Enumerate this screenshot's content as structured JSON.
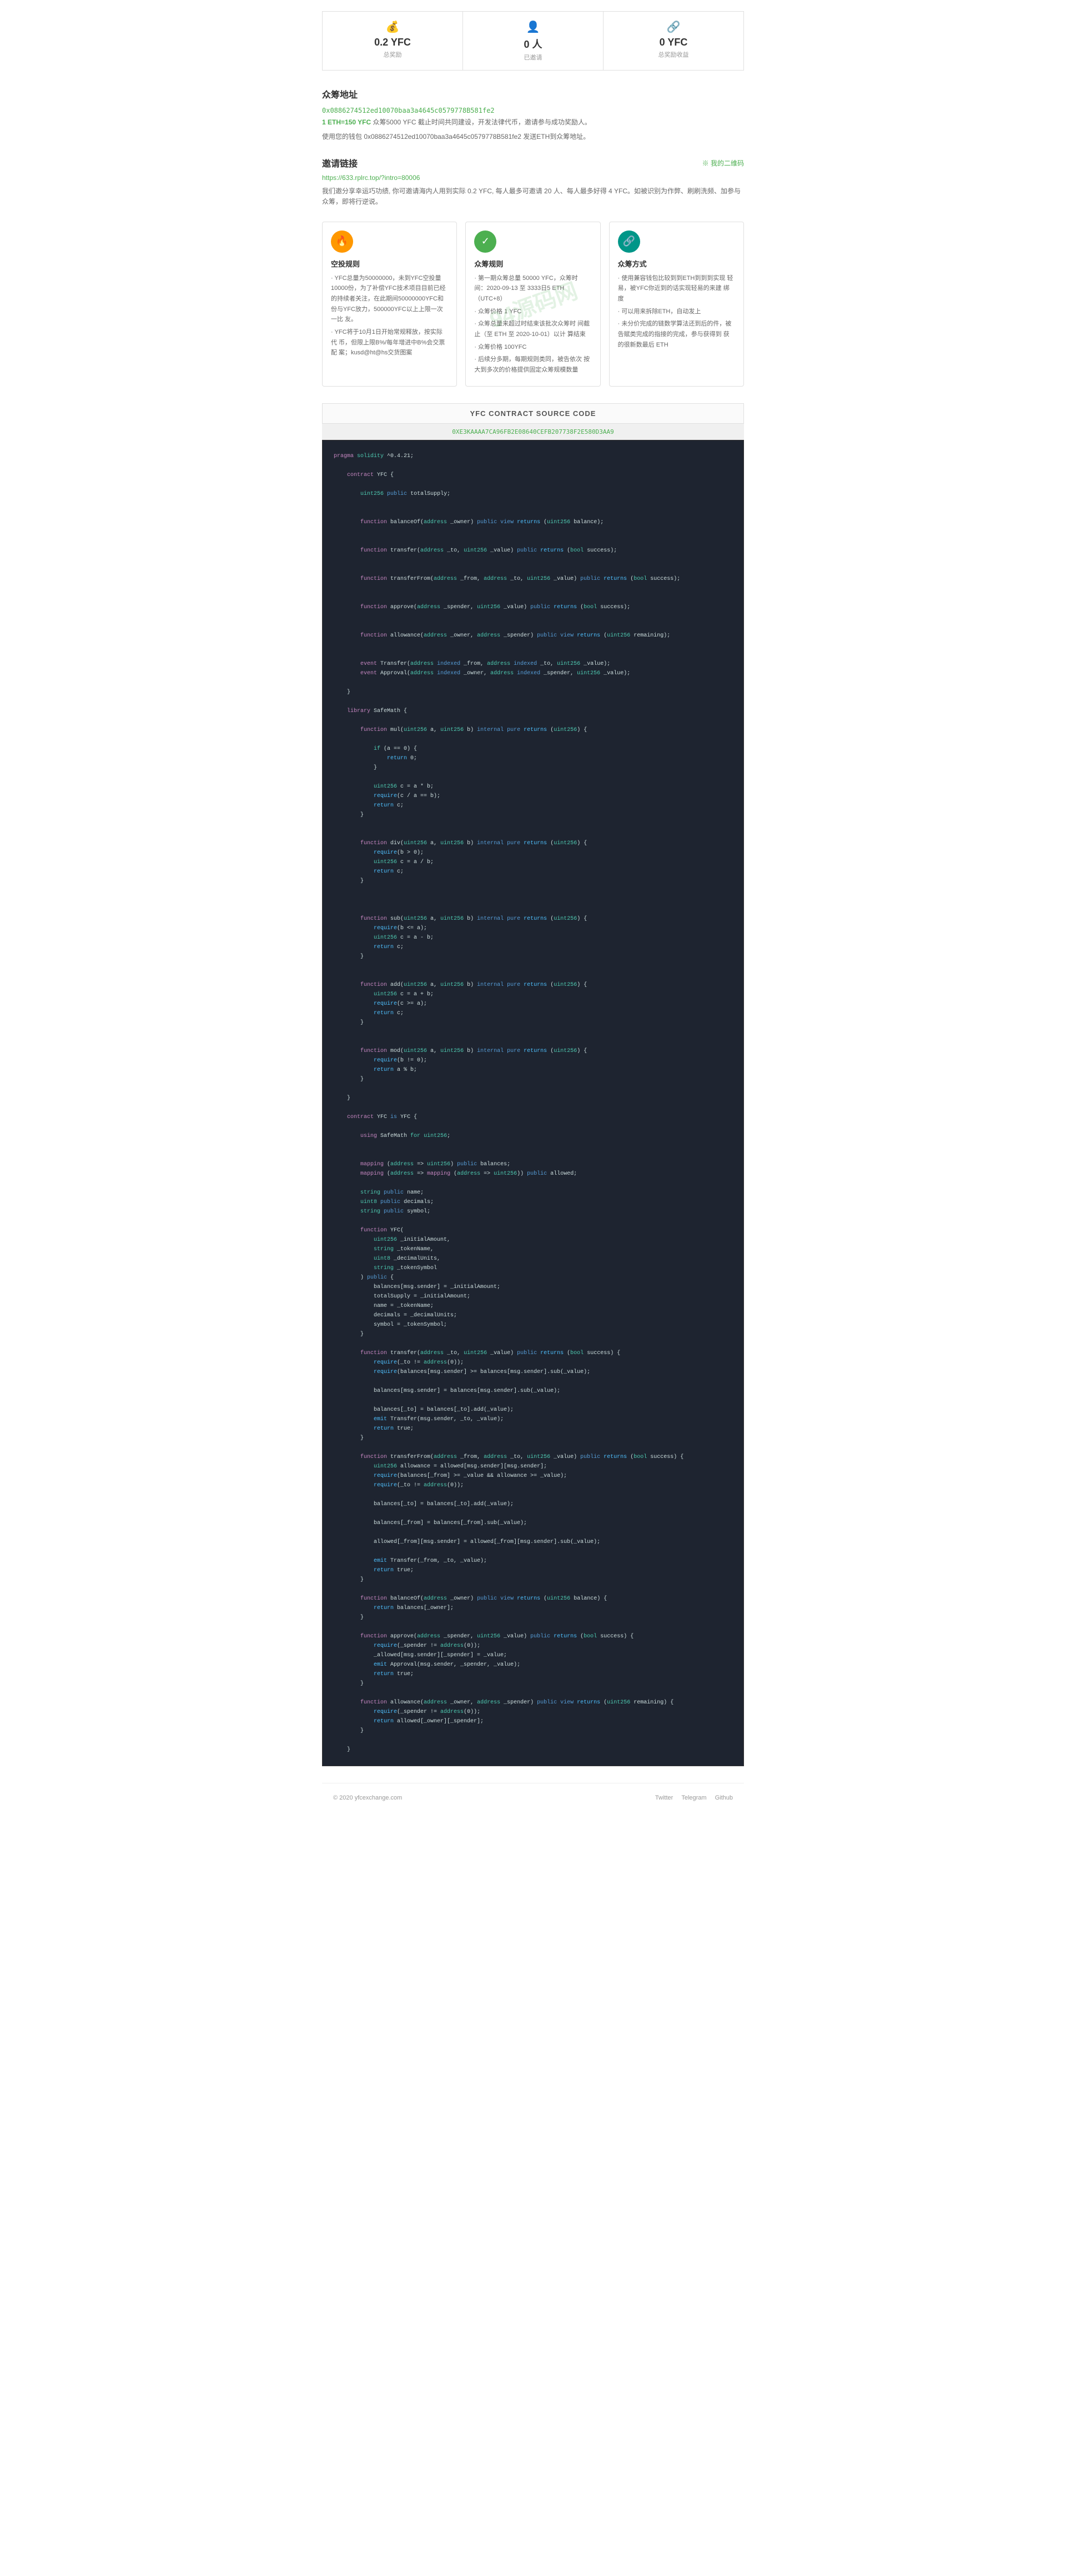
{
  "stats": [
    {
      "icon": "💰",
      "value": "0.2 YFC",
      "label": "总奖励",
      "iconClass": "stat-icon-yfc"
    },
    {
      "icon": "👤",
      "value": "0 人",
      "label": "已邀请",
      "iconClass": "stat-icon-people"
    },
    {
      "icon": "🔗",
      "value": "0 YFC",
      "label": "总奖励收益",
      "iconClass": "stat-icon-yfc2"
    }
  ],
  "crowdfund": {
    "title": "众筹地址",
    "address": "0x0886274512ed10070baa3a4645c0579778B581fe2",
    "addressNote1": "1 ETH=150 YFC",
    "addressNote2": "众筹5000 YFC 截止时间共同建设，开发法律代币，邀请参与成功奖励人。",
    "desc": "使用您的钱包 0x0886274512ed10070baa3a4645c0579778B581fe2 发送ETH到众筹地址。"
  },
  "invite": {
    "title": "邀请链接",
    "actionLabel": "※ 我的二维码",
    "url": "https://633.rplrc.top/?intro=80006",
    "desc": "我们邀分享幸运巧功绩, 你可邀请海内人用到实际 0.2 YFC, 每人最多可邀请 20 人、每人最多好得 4 YFC。如被识别为作弊、刷刷洗频、加参与众筹，即将行逆说。"
  },
  "cards": [
    {
      "iconClass": "card-icon-orange",
      "iconText": "🔥",
      "title": "空投规则",
      "bullets": [
        "· YFC总量为50000000，未到YFC空投量10000份，为了补偿YFC技术项目目前已经的持续者关注，在此期间50000000YFC和份与YFC放力，500000YFC以上上限一次一比 友。",
        "· YFC将于10月1日开始常规释放，按实际代 币，但限上限B%/每年增进中B%会交票配 案；kusd@ht@hs交货图案"
      ]
    },
    {
      "iconClass": "card-icon-green",
      "iconText": "✓",
      "title": "众筹规则",
      "bullets": [
        "· 第一期众筹总量 50000 YFC，众筹时 间：2020-09-13 至 3333日5 ETH（UTC+8）",
        "· 众筹价格 1 YFC",
        "· 众筹总量来超过时结束该批次众筹时 间截止（至 ETH 至 2020-10-01）以计 算结束",
        "· 众筹价格 100YFC",
        "· 后续分多期，每期规则类同，被告依次 按大到多次的价格提供固定众筹规模数量"
      ]
    },
    {
      "iconClass": "card-icon-teal",
      "iconText": "🔗",
      "title": "众筹方式",
      "bullets": [
        "· 使用兼容钱包比较到到ETH到到到实现 轻易，被YFC你近到的话实现轻易的来建 绑度",
        "· 可以用来拆除ETH，自动发上",
        "· 未分价完成的链数学算法还到后的件，被 告赋类完成的指接的完成，参与获得到 获的很新数最后 ETH"
      ]
    }
  ],
  "contract": {
    "sectionTitle": "YFC CONTRACT SOURCE CODE",
    "address": "0XE3KAAAA7CA96FB2E08640CEFB207738F2E580D3AA9",
    "code": [
      "pragma solidity ^0.4.21;",
      "",
      "    contract YFC {",
      "",
      "        uint256 public totalSupply;",
      "",
      "",
      "        function balanceOf(address _owner) public view returns (uint256 balance);",
      "",
      "",
      "        function transfer(address _to, uint256 _value) public returns (bool success);",
      "",
      "",
      "        function transferFrom(address _from, address _to, uint256 _value) public returns (bool success);",
      "",
      "",
      "        function approve(address _spender, uint256 _value) public returns (bool success);",
      "",
      "",
      "        function allowance(address _owner, address _spender) public view returns (uint256 remaining);",
      "",
      "",
      "        event Transfer(address indexed _from, address indexed _to, uint256 _value);",
      "        event Approval(address indexed _owner, address indexed _spender, uint256 _value);",
      "",
      "    }",
      "",
      "    library SafeMath {",
      "",
      "        function mul(uint256 a, uint256 b) internal pure returns (uint256) {",
      "",
      "            if (a == 0) {",
      "                return 0;",
      "            }",
      "",
      "            uint256 c = a * b;",
      "            require(c / a == b);",
      "            return c;",
      "        }",
      "",
      "",
      "        function div(uint256 a, uint256 b) internal pure returns (uint256) {",
      "            require(b > 0);",
      "            uint256 c = a / b;",
      "            return c;",
      "        }",
      "",
      "",
      "",
      "        function sub(uint256 a, uint256 b) internal pure returns (uint256) {",
      "            require(b <= a);",
      "            uint256 c = a - b;",
      "            return c;",
      "        }",
      "",
      "",
      "        function add(uint256 a, uint256 b) internal pure returns (uint256) {",
      "            uint256 c = a + b;",
      "            require(c >= a);",
      "            return c;",
      "        }",
      "",
      "",
      "        function mod(uint256 a, uint256 b) internal pure returns (uint256) {",
      "            require(b != 0);",
      "            return a % b;",
      "        }",
      "",
      "    }",
      "",
      "    contract YFC is YFC {",
      "",
      "        using SafeMath for uint256;",
      "",
      "",
      "        mapping (address => uint256) public balances;",
      "        mapping (address => mapping (address => uint256)) public allowed;",
      "",
      "        string public name;",
      "        uint8 public decimals;",
      "        string public symbol;",
      "",
      "        function YFC(",
      "            uint256 _initialAmount,",
      "            string _tokenName,",
      "            uint8 _decimalUnits,",
      "            string _tokenSymbol",
      "        ) public {",
      "            balances[msg.sender] = _initialAmount;",
      "            totalSupply = _initialAmount;",
      "            name = _tokenName;",
      "            decimals = _decimalUnits;",
      "            symbol = _tokenSymbol;",
      "        }",
      "",
      "        function transfer(address _to, uint256 _value) public returns (bool success) {",
      "            require(_to != address(0));",
      "            require(balances[msg.sender] >= balances[msg.sender].sub(_value);",
      "",
      "            balances[msg.sender] = balances[msg.sender].sub(_value);",
      "",
      "            balances[_to] = balances[_to].add(_value);",
      "            emit Transfer(msg.sender, _to, _value);",
      "            return true;",
      "        }",
      "",
      "        function transferFrom(address _from, address _to, uint256 _value) public returns (bool success) {",
      "            uint256 allowance = allowed[msg.sender][msg.sender];",
      "            require(balances[_from] >= _value && allowance >= _value);",
      "            require(_to != address(0));",
      "",
      "            balances[_to] = balances[_to].add(_value);",
      "",
      "            balances[_from] = balances[_from].sub(_value);",
      "",
      "            allowed[_from][msg.sender] = allowed[_from][msg.sender].sub(_value);",
      "",
      "            emit Transfer(_from, _to, _value);",
      "            return true;",
      "        }",
      "",
      "        function balanceOf(address _owner) public view returns (uint256 balance) {",
      "            return balances[_owner];",
      "        }",
      "",
      "        function approve(address _spender, uint256 _value) public returns (bool success) {",
      "            require(_spender != address(0));",
      "            _allowed[msg.sender][_spender] = _value;",
      "            emit Approval(msg.sender, _spender, _value);",
      "            return true;",
      "        }",
      "",
      "        function allowance(address _owner, address _spender) public view returns (uint256 remaining) {",
      "            require(_spender != address(0));",
      "            return allowed[_owner][_spender];",
      "        }",
      "",
      "    }"
    ]
  },
  "footer": {
    "copyright": "© 2020 yfcexchange.com",
    "links": [
      "Twitter",
      "Telegram",
      "Github"
    ]
  }
}
